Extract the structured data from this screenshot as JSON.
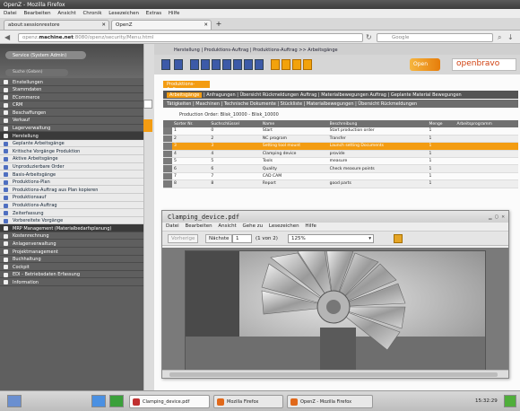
{
  "window": {
    "title": "OpenZ - Mozilla Firefox"
  },
  "menubar": [
    "Datei",
    "Bearbeiten",
    "Ansicht",
    "Chronik",
    "Lesezeichen",
    "Extras",
    "Hilfe"
  ],
  "tabs": [
    {
      "label": "about:sessionrestore"
    },
    {
      "label": "OpenZ"
    }
  ],
  "navbar": {
    "url_prefix": "openz.",
    "url_host": "machine.net",
    "url_rest": ":8080/openz/security/Menu.html",
    "search_placeholder": "Google"
  },
  "sidebar": {
    "user_label": "Service (System Admin)",
    "search_placeholder": "Suche (Geben)",
    "items": [
      {
        "label": "Einstellungen",
        "kind": "main"
      },
      {
        "label": "Stammdaten",
        "kind": "main"
      },
      {
        "label": "ECommerce",
        "kind": "main"
      },
      {
        "label": "CRM",
        "kind": "main"
      },
      {
        "label": "Beschaffungen",
        "kind": "main"
      },
      {
        "label": "Verkauf",
        "kind": "main"
      },
      {
        "label": "Lagerverwaltung",
        "kind": "main"
      },
      {
        "label": "Herstellung",
        "kind": "dark"
      },
      {
        "label": "Geplante Arbeitsgänge",
        "kind": "sub"
      },
      {
        "label": "Kritische Vorgänge Produktion",
        "kind": "sub"
      },
      {
        "label": "Aktive Arbeitsgänge",
        "kind": "sub"
      },
      {
        "label": "Unproduzierbare Order",
        "kind": "sub"
      },
      {
        "label": "Basis-Arbeitsgänge",
        "kind": "sub"
      },
      {
        "label": "Produktions-Plan",
        "kind": "sub"
      },
      {
        "label": "Produktions-Auftrag aus Plan kopieren",
        "kind": "sub"
      },
      {
        "label": "Produktionsauf",
        "kind": "sub"
      },
      {
        "label": "Produktions-Auftrag",
        "kind": "sub"
      },
      {
        "label": "Zeiterfassung",
        "kind": "sub"
      },
      {
        "label": "Vorbereitete Vorgänge",
        "kind": "sub"
      },
      {
        "label": "MRP Management (Materialbedarfsplanung)",
        "kind": "dark"
      },
      {
        "label": "Kostenrechnung",
        "kind": "main"
      },
      {
        "label": "Anlagenverwaltung",
        "kind": "main"
      },
      {
        "label": "Projektmanagement",
        "kind": "main"
      },
      {
        "label": "Buchhaltung",
        "kind": "main"
      },
      {
        "label": "Cockpit",
        "kind": "main"
      },
      {
        "label": "EDI - Betriebsdaten Erfassung",
        "kind": "main"
      },
      {
        "label": "Information",
        "kind": "main"
      }
    ]
  },
  "main": {
    "breadcrumb": "Herstellung | Produktions-Auftrag | Produktions-Auftrag >> Arbeitsgänge",
    "logo_open": "Open",
    "logo_brand": "openbravo",
    "section_tab": "Produktions-Auftrag",
    "tabs1_active": "Arbeitsgänge",
    "tabs1_rest": "| Anfragungen | Übersicht Rückmeldungen Auftrag | Materialbewegungen Auftrag | Geplante Material Bewegungen",
    "tabs2": "Tätigkeiten | Maschinen | Technische Dokumente | Stückliste | Materialbewegungen | Übersicht Rückmeldungen",
    "order_line": "Production Order: Blisk_10000 - Blisk_10000",
    "table": {
      "headers": [
        "",
        "Sorter Nr.",
        "Suchschlüssel",
        "Name",
        "Beschreibung",
        "",
        "Menge",
        "Arbeitsprogramm"
      ],
      "rows": [
        {
          "no": "1",
          "key": "0",
          "name": "Start",
          "desc": "Start production order",
          "qty": "1",
          "sel": false
        },
        {
          "no": "2",
          "key": "2",
          "name": "NC program",
          "desc": "Transfer",
          "qty": "1",
          "sel": false
        },
        {
          "no": "3",
          "key": "3",
          "name": "Setting tool mount",
          "desc": "Launch setting Documents",
          "qty": "1",
          "sel": true
        },
        {
          "no": "4",
          "key": "4",
          "name": "Clamping device",
          "desc": "provide",
          "qty": "1",
          "sel": false
        },
        {
          "no": "5",
          "key": "5",
          "name": "Tools",
          "desc": "measure",
          "qty": "1",
          "sel": false
        },
        {
          "no": "6",
          "key": "6",
          "name": "Quality",
          "desc": "Check measure points",
          "qty": "1",
          "sel": false
        },
        {
          "no": "7",
          "key": "7",
          "name": "CAD CAM",
          "desc": "",
          "qty": "1",
          "sel": false
        },
        {
          "no": "8",
          "key": "8",
          "name": "Report",
          "desc": "good parts",
          "qty": "1",
          "sel": false
        }
      ]
    }
  },
  "pdf": {
    "title": "Clamping_device.pdf",
    "menu": [
      "Datei",
      "Bearbeiten",
      "Ansicht",
      "Gehe zu",
      "Lesezeichen",
      "Hilfe"
    ],
    "prev_label": "Vorherige",
    "next_label": "Nächste",
    "page_value": "1",
    "page_of": "(1 von 2)",
    "zoom": "125%"
  },
  "taskbar": {
    "items": [
      "Clamping_device.pdf",
      "Mozilla Firefox",
      "OpenZ - Mozilla Firefox"
    ],
    "clock": "15:32:29"
  },
  "colors": {
    "accent_orange": "#f39c12",
    "sidebar_grey": "#5f5f5f",
    "brand_blue": "#3c5aa8"
  }
}
